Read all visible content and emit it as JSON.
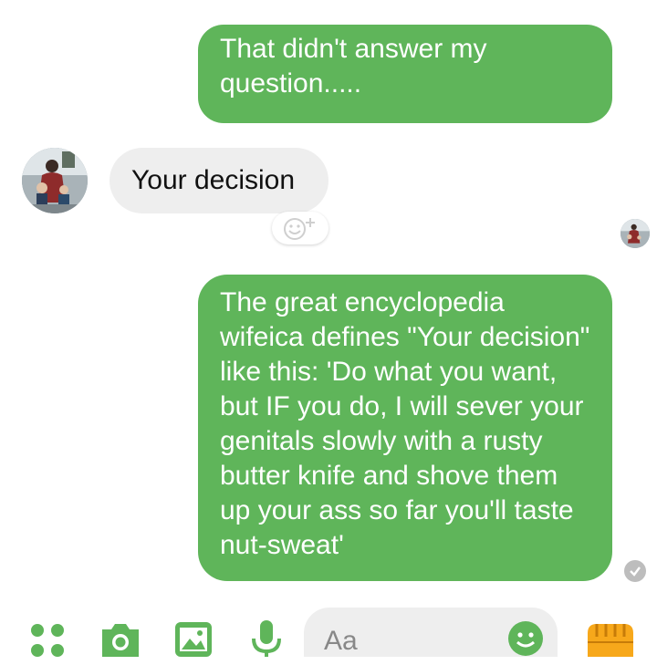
{
  "messages": {
    "outgoing_1": "That didn't answer my question.....",
    "incoming_1": "Your decision",
    "outgoing_2": "The great encyclopedia wifeica defines \"Your decision\" like this: 'Do what you want, but IF you do, I will sever your genitals slowly with a rusty butter knife and shove them up your ass so far you'll taste nut-sweat'"
  },
  "composer": {
    "placeholder": "Aa"
  },
  "icons": {
    "more": "grid-dots-icon",
    "camera": "camera-icon",
    "gallery": "image-icon",
    "mic": "microphone-icon",
    "emoji": "smiley-icon",
    "like": "thumbs-up-fist-icon",
    "reaction": "add-reaction-icon",
    "seen": "seen-check-icon"
  },
  "colors": {
    "accent": "#5fb55a",
    "incoming_bubble": "#eeeeee",
    "like_icon": "#f7a81b"
  }
}
